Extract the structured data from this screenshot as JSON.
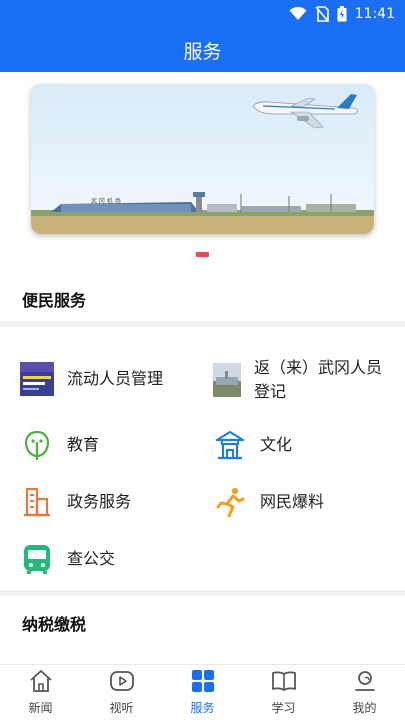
{
  "status": {
    "time": "11:41"
  },
  "header": {
    "title": "服务"
  },
  "sections": {
    "convenience": "便民服务",
    "tax": "纳税缴税"
  },
  "services": [
    {
      "label": "流动人员管理",
      "icon": "floating-population-icon"
    },
    {
      "label": "返（来）武冈人员登记",
      "icon": "registration-icon"
    },
    {
      "label": "教育",
      "icon": "education-icon"
    },
    {
      "label": "文化",
      "icon": "culture-icon"
    },
    {
      "label": "政务服务",
      "icon": "government-service-icon"
    },
    {
      "label": "网民爆料",
      "icon": "report-icon"
    },
    {
      "label": "查公交",
      "icon": "bus-icon"
    }
  ],
  "tabs": [
    {
      "label": "新闻",
      "icon": "home-icon"
    },
    {
      "label": "视听",
      "icon": "video-icon"
    },
    {
      "label": "服务",
      "icon": "grid-icon",
      "active": true
    },
    {
      "label": "学习",
      "icon": "book-icon"
    },
    {
      "label": "我的",
      "icon": "profile-icon"
    }
  ],
  "colors": {
    "primary": "#1a6ff5",
    "indicator": "#e84b4b"
  }
}
